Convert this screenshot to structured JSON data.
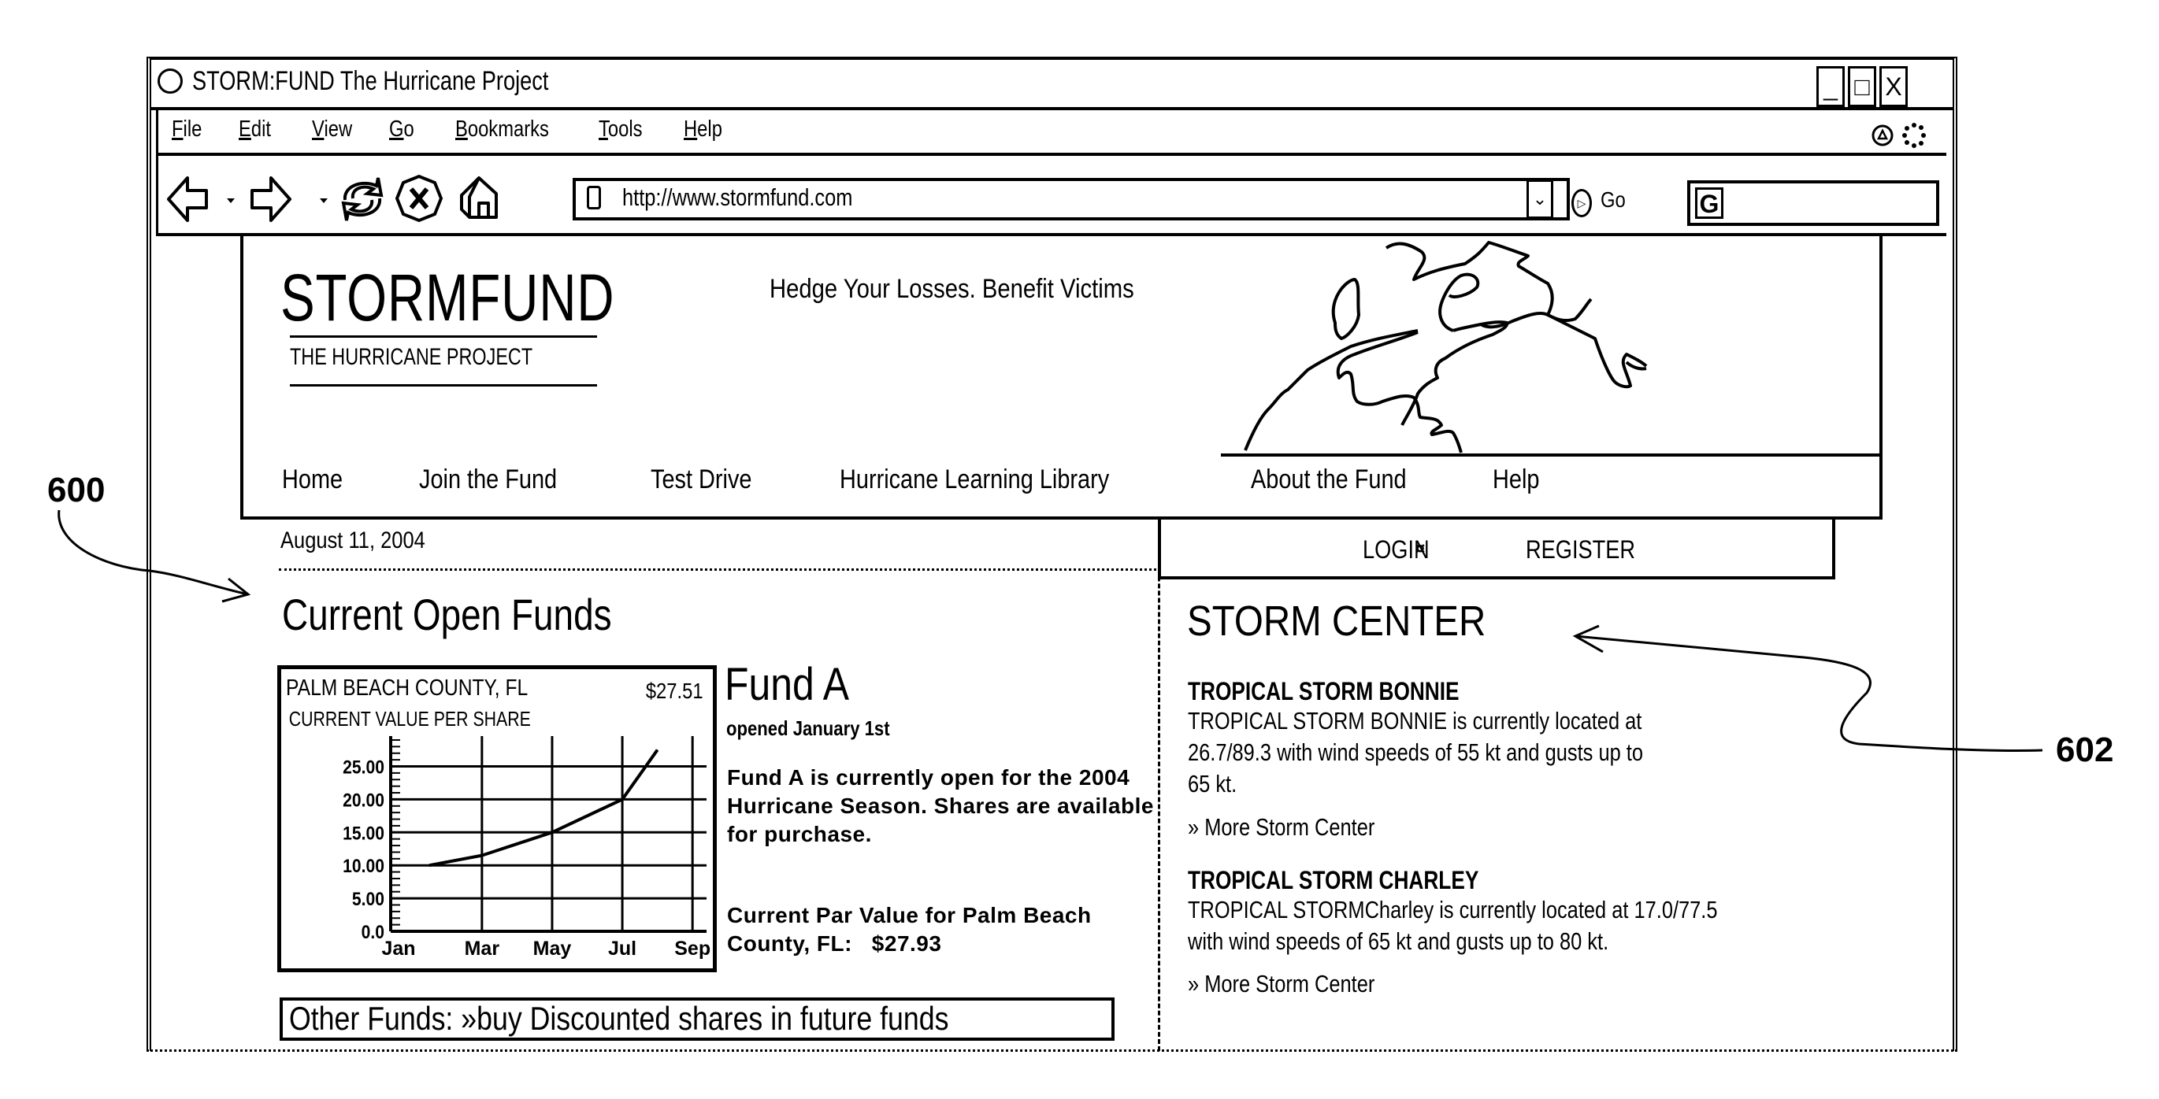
{
  "window": {
    "title": "STORM:FUND  The Hurricane Project",
    "controls": [
      "_",
      "□",
      "X"
    ]
  },
  "menubar": {
    "items": [
      {
        "label_first": "F",
        "label_rest": "ile"
      },
      {
        "label_first": "E",
        "label_rest": "dit"
      },
      {
        "label_first": "V",
        "label_rest": "iew"
      },
      {
        "label_first": "G",
        "label_rest": "o"
      },
      {
        "label_first": "B",
        "label_rest": "ookmarks"
      },
      {
        "label_first": "T",
        "label_rest": "ools"
      },
      {
        "label_first": "H",
        "label_rest": "elp"
      }
    ]
  },
  "toolbar": {
    "url": "http://www.stormfund.com",
    "go_label": "Go",
    "dropdown_glyph": "⌄",
    "search_glyph": "G"
  },
  "site": {
    "logo": "STORMFUND",
    "logo_sub": "THE HURRICANE PROJECT",
    "tagline": "Hedge Your Losses.  Benefit Victims",
    "nav": [
      "Home",
      "Join the Fund",
      "Test Drive",
      "Hurricane Learning Library",
      "About the Fund",
      "Help"
    ],
    "date": "August 11, 2004",
    "login": "LOGIN",
    "login_sep": "¤",
    "register": "REGISTER"
  },
  "funds": {
    "section_title": "Current Open Funds",
    "fund_name": "Fund A",
    "opened": "opened January 1st",
    "description": "Fund A is currently open for the 2004 Hurricane Season. Shares are available for purchase.",
    "par_value_text": "Current Par Value for Palm Beach County, FL:",
    "par_value": "$27.93",
    "other_funds_label": "Other Funds:",
    "other_funds_link": "»buy Discounted shares in future funds"
  },
  "chart_data": {
    "type": "line",
    "title": "PALM BEACH COUNTY, FL",
    "subtitle": "CURRENT VALUE PER SHARE",
    "current_value": "$27.51",
    "categories": [
      "Jan",
      "Mar",
      "May",
      "Jul",
      "Sep"
    ],
    "y_ticks": [
      "0.0",
      "5.00",
      "10.00",
      "15.00",
      "20.00",
      "25.00"
    ],
    "ylim": [
      0,
      29
    ],
    "xlim": [
      0,
      9
    ],
    "grid": true,
    "series": [
      {
        "name": "Value per share",
        "x": [
          0.5,
          2,
          4,
          6,
          7.0
        ],
        "y": [
          10,
          11.5,
          15,
          20,
          27.5
        ]
      }
    ],
    "xlabel": "",
    "ylabel": ""
  },
  "storm_center": {
    "title": "STORM CENTER",
    "storms": [
      {
        "name": "TROPICAL STORM BONNIE",
        "lines": [
          "TROPICAL STORM BONNIE is currently located at",
          "26.7/89.3 with wind speeds of 55 kt and gusts up to",
          "65 kt."
        ],
        "more": "» More Storm Center"
      },
      {
        "name": "TROPICAL STORM CHARLEY",
        "lines": [
          "TROPICAL STORMCharley is currently located at 17.0/77.5",
          "with wind speeds of 65 kt and gusts up to 80 kt."
        ],
        "more": "» More Storm Center"
      }
    ]
  },
  "annotations": {
    "left_ref": "600",
    "right_ref": "602"
  }
}
